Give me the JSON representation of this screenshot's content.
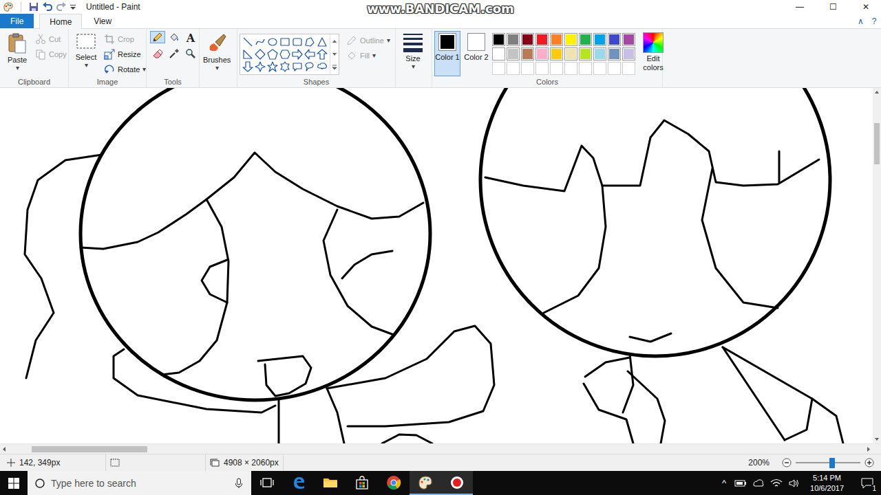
{
  "window": {
    "title": "Untitled - Paint",
    "controls": [
      {
        "kind": "minimize",
        "glyph": "—"
      },
      {
        "kind": "maximize",
        "glyph": "☐"
      },
      {
        "kind": "close",
        "glyph": "✕"
      }
    ]
  },
  "watermark": "www.BANDICAM.com",
  "tabs": [
    {
      "label": "File",
      "kind": "file",
      "selected": false
    },
    {
      "label": "Home",
      "kind": "tab",
      "selected": true
    },
    {
      "label": "View",
      "kind": "tab",
      "selected": false
    }
  ],
  "ribbon_controls": [
    "∧",
    "?"
  ],
  "clipboard": {
    "label": "Clipboard",
    "paste": {
      "label": "Paste",
      "arrow": "▾"
    },
    "items": [
      {
        "label": "Cut",
        "kind": "cut",
        "disabled": true
      },
      {
        "label": "Copy",
        "kind": "copy",
        "disabled": true
      }
    ]
  },
  "image": {
    "label": "Image",
    "select": {
      "label": "Select",
      "arrow": "▾"
    },
    "items": [
      {
        "label": "Crop",
        "kind": "crop",
        "disabled": true
      },
      {
        "label": "Resize",
        "kind": "resize",
        "disabled": false
      },
      {
        "label": "Rotate",
        "kind": "rotate",
        "disabled": false,
        "arrow": "▾"
      }
    ]
  },
  "tools": {
    "label": "Tools",
    "items": [
      {
        "kind": "pencil",
        "selected": true
      },
      {
        "kind": "fill",
        "selected": false
      },
      {
        "kind": "text",
        "glyph": "A",
        "selected": false
      },
      {
        "kind": "eraser",
        "selected": false
      },
      {
        "kind": "picker",
        "selected": false
      },
      {
        "kind": "magnifier",
        "selected": false
      }
    ]
  },
  "brushes": {
    "label": "Brushes",
    "arrow": "▾"
  },
  "shapes": {
    "label": "Shapes",
    "options": [
      {
        "label": "Outline",
        "kind": "outline",
        "disabled": true,
        "arrow": "▾"
      },
      {
        "label": "Fill",
        "kind": "fill",
        "disabled": true,
        "arrow": "▾"
      }
    ]
  },
  "size": {
    "label": "Size",
    "arrow": "▾"
  },
  "colors": {
    "label": "Colors",
    "slots": [
      {
        "label": "Color 1",
        "color": "#000000",
        "selected": true
      },
      {
        "label": "Color 2",
        "color": "#ffffff",
        "selected": false
      }
    ],
    "palette": [
      {
        "color": "#000000"
      },
      {
        "color": "#7f7f7f"
      },
      {
        "color": "#880015"
      },
      {
        "color": "#ed1c24"
      },
      {
        "color": "#ff7f27"
      },
      {
        "color": "#fff200"
      },
      {
        "color": "#22b14c"
      },
      {
        "color": "#00a2e8"
      },
      {
        "color": "#3f48cc"
      },
      {
        "color": "#a349a4"
      },
      {
        "color": "#ffffff"
      },
      {
        "color": "#c3c3c3"
      },
      {
        "color": "#b97a57"
      },
      {
        "color": "#ffaec9"
      },
      {
        "color": "#ffc90e"
      },
      {
        "color": "#efe4b0"
      },
      {
        "color": "#b5e61d"
      },
      {
        "color": "#99d9ea"
      },
      {
        "color": "#7092be"
      },
      {
        "color": "#c8bfe7"
      }
    ],
    "custom": [
      {
        "filled": false
      },
      {
        "filled": false
      },
      {
        "filled": false
      },
      {
        "filled": false
      },
      {
        "filled": false
      },
      {
        "filled": false
      },
      {
        "filled": false
      },
      {
        "filled": false
      },
      {
        "filled": false
      },
      {
        "filled": false
      }
    ],
    "edit": "Edit colors"
  },
  "scroll": {
    "vertical": 0.09,
    "horizontal": 0.03
  },
  "status_bar": {
    "cursor": "142, 349px",
    "canvas_size": "4908 × 2060px",
    "zoom": "200%",
    "zoom_level": 0.57
  },
  "taskbar": {
    "search_placeholder": "Type here to search",
    "apps": [
      {
        "kind": "task-view",
        "running": false
      },
      {
        "kind": "edge",
        "running": false
      },
      {
        "kind": "explorer",
        "running": false
      },
      {
        "kind": "store",
        "running": false
      },
      {
        "kind": "chrome",
        "running": false
      },
      {
        "kind": "paint",
        "running": true
      },
      {
        "kind": "bandicam",
        "running": true
      }
    ],
    "tray_arrow": "^",
    "time": "5:14 PM",
    "date": "10/6/2017",
    "notifications": "1"
  }
}
